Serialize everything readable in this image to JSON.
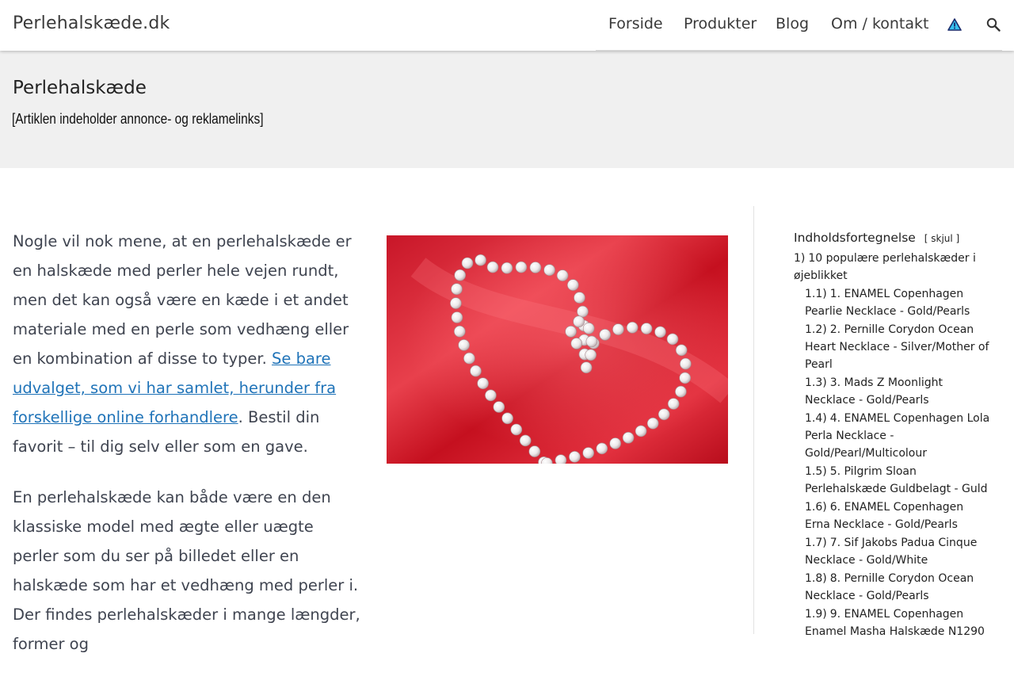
{
  "header": {
    "site_title": "Perlehalskæde.dk",
    "nav": {
      "forside": "Forside",
      "produkter": "Produkter",
      "blog": "Blog",
      "om": "Om / kontakt"
    },
    "icons": [
      "warning-icon",
      "search-icon"
    ]
  },
  "banner": {
    "title": "Perlehalskæde",
    "ad_note": "[Artiklen indeholder annonce- og reklamelinks]"
  },
  "article": {
    "p1_start": "Nogle vil nok mene, at en perlehalskæde er en halskæde med perler hele vejen rundt, men det kan også være en kæde i et andet materiale med en perle som vedhæng eller en kombination af disse to typer. ",
    "p1_link": "Se bare udvalget, som vi har samlet, herunder fra forskellige online forhandlere",
    "p1_end": ". Bestil din favorit – til dig selv eller som en gave.",
    "p2": "En perlehalskæde kan både være en den klassiske model med ægte eller uægte perler som du ser på billedet eller en halskæde som har et vedhæng med perler i. Der findes perlehalskæder i mange længder, former og"
  },
  "toc": {
    "title": "Indholdsfortegnelse",
    "toggle": "[ skjul ]",
    "items": [
      {
        "num": "1)",
        "label": "10 populære perlehalskæder i øjeblikket"
      },
      {
        "num": "1.1)",
        "label": "1. ENAMEL Copenhagen Pearlie Necklace - Gold/Pearls"
      },
      {
        "num": "1.2)",
        "label": "2. Pernille Corydon Ocean Heart Necklace - Silver/Mother of Pearl"
      },
      {
        "num": "1.3)",
        "label": "3. Mads Z Moonlight Necklace - Gold/Pearls"
      },
      {
        "num": "1.4)",
        "label": "4. ENAMEL Copenhagen Lola Perla Necklace - Gold/Pearl/Multicolour"
      },
      {
        "num": "1.5)",
        "label": "5. Pilgrim Sloan Perlehalskæde Guldbelagt - Guld"
      },
      {
        "num": "1.6)",
        "label": "6. ENAMEL Copenhagen Erna Necklace - Gold/Pearls"
      },
      {
        "num": "1.7)",
        "label": "7. Sif Jakobs Padua Cinque Necklace - Gold/White"
      },
      {
        "num": "1.8)",
        "label": "8. Pernille Corydon Ocean Necklace - Gold/Pearls"
      },
      {
        "num": "1.9)",
        "label": "9. ENAMEL Copenhagen Enamel Masha Halskæde N1290"
      }
    ]
  },
  "colors": {
    "link": "#1f73b8",
    "banner_bg": "#f0f0f0",
    "text": "#3f4450"
  }
}
